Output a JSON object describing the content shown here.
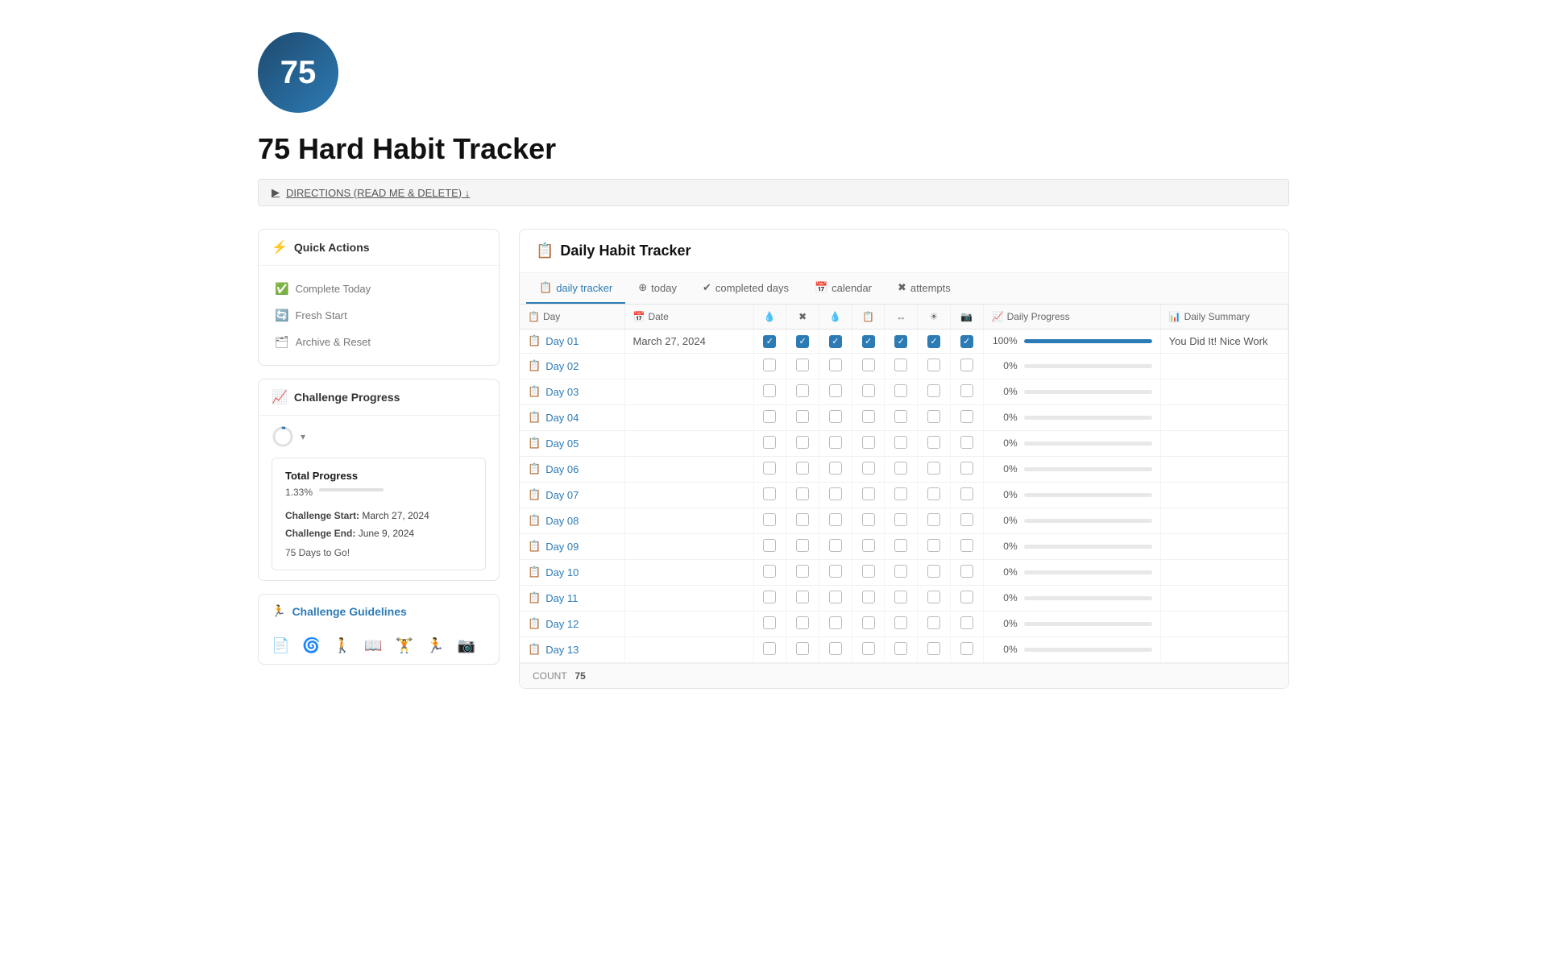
{
  "header": {
    "logo_number": "75",
    "page_title": "75 Hard Habit Tracker",
    "directions_label": "DIRECTIONS (READ ME & DELETE) ↓"
  },
  "sidebar": {
    "quick_actions_title": "Quick Actions",
    "actions": [
      {
        "id": "complete-today",
        "label": "Complete Today",
        "icon": "✅"
      },
      {
        "id": "fresh-start",
        "label": "Fresh Start",
        "icon": "🔄"
      },
      {
        "id": "archive-reset",
        "label": "Archive & Reset",
        "icon": "🗂"
      }
    ],
    "challenge_progress_title": "Challenge Progress",
    "total_progress": {
      "title": "Total Progress",
      "pct": "1.33%",
      "start_label": "Challenge Start:",
      "start_date": "March 27, 2024",
      "end_label": "Challenge End:",
      "end_date": "June 9, 2024",
      "days_to_go": "75 Days to Go!"
    },
    "guidelines_title": "Challenge Guidelines",
    "guidelines_icons": [
      "📄",
      "🌀",
      "🚶",
      "📖",
      "🏋",
      "🏃",
      "📷"
    ]
  },
  "tracker": {
    "title": "Daily Habit Tracker",
    "tabs": [
      {
        "id": "daily-tracker",
        "label": "daily tracker",
        "active": true
      },
      {
        "id": "today",
        "label": "today",
        "active": false
      },
      {
        "id": "completed-days",
        "label": "completed days",
        "active": false
      },
      {
        "id": "calendar",
        "label": "calendar",
        "active": false
      },
      {
        "id": "attempts",
        "label": "attempts",
        "active": false
      }
    ],
    "columns": [
      {
        "id": "day",
        "label": "Day"
      },
      {
        "id": "date",
        "label": "Date"
      },
      {
        "id": "h1",
        "label": "💧"
      },
      {
        "id": "h2",
        "label": "❌"
      },
      {
        "id": "h3",
        "label": "💧"
      },
      {
        "id": "h4",
        "label": "📋"
      },
      {
        "id": "h5",
        "label": "↔"
      },
      {
        "id": "h6",
        "label": "☀"
      },
      {
        "id": "h7",
        "label": "📷"
      },
      {
        "id": "progress",
        "label": "Daily Progress"
      },
      {
        "id": "summary",
        "label": "Daily Summary"
      }
    ],
    "rows": [
      {
        "day": "Day 01",
        "date": "March 27, 2024",
        "checks": [
          true,
          true,
          true,
          true,
          true,
          true,
          true
        ],
        "pct": 100,
        "summary": "You Did It! Nice Work"
      },
      {
        "day": "Day 02",
        "date": "",
        "checks": [
          false,
          false,
          false,
          false,
          false,
          false,
          false
        ],
        "pct": 0,
        "summary": ""
      },
      {
        "day": "Day 03",
        "date": "",
        "checks": [
          false,
          false,
          false,
          false,
          false,
          false,
          false
        ],
        "pct": 0,
        "summary": ""
      },
      {
        "day": "Day 04",
        "date": "",
        "checks": [
          false,
          false,
          false,
          false,
          false,
          false,
          false
        ],
        "pct": 0,
        "summary": ""
      },
      {
        "day": "Day 05",
        "date": "",
        "checks": [
          false,
          false,
          false,
          false,
          false,
          false,
          false
        ],
        "pct": 0,
        "summary": ""
      },
      {
        "day": "Day 06",
        "date": "",
        "checks": [
          false,
          false,
          false,
          false,
          false,
          false,
          false
        ],
        "pct": 0,
        "summary": ""
      },
      {
        "day": "Day 07",
        "date": "",
        "checks": [
          false,
          false,
          false,
          false,
          false,
          false,
          false
        ],
        "pct": 0,
        "summary": ""
      },
      {
        "day": "Day 08",
        "date": "",
        "checks": [
          false,
          false,
          false,
          false,
          false,
          false,
          false
        ],
        "pct": 0,
        "summary": ""
      },
      {
        "day": "Day 09",
        "date": "",
        "checks": [
          false,
          false,
          false,
          false,
          false,
          false,
          false
        ],
        "pct": 0,
        "summary": ""
      },
      {
        "day": "Day 10",
        "date": "",
        "checks": [
          false,
          false,
          false,
          false,
          false,
          false,
          false
        ],
        "pct": 0,
        "summary": ""
      },
      {
        "day": "Day 11",
        "date": "",
        "checks": [
          false,
          false,
          false,
          false,
          false,
          false,
          false
        ],
        "pct": 0,
        "summary": ""
      },
      {
        "day": "Day 12",
        "date": "",
        "checks": [
          false,
          false,
          false,
          false,
          false,
          false,
          false
        ],
        "pct": 0,
        "summary": ""
      },
      {
        "day": "Day 13",
        "date": "",
        "checks": [
          false,
          false,
          false,
          false,
          false,
          false,
          false
        ],
        "pct": 0,
        "summary": ""
      }
    ],
    "count_label": "COUNT",
    "count_value": "75"
  }
}
